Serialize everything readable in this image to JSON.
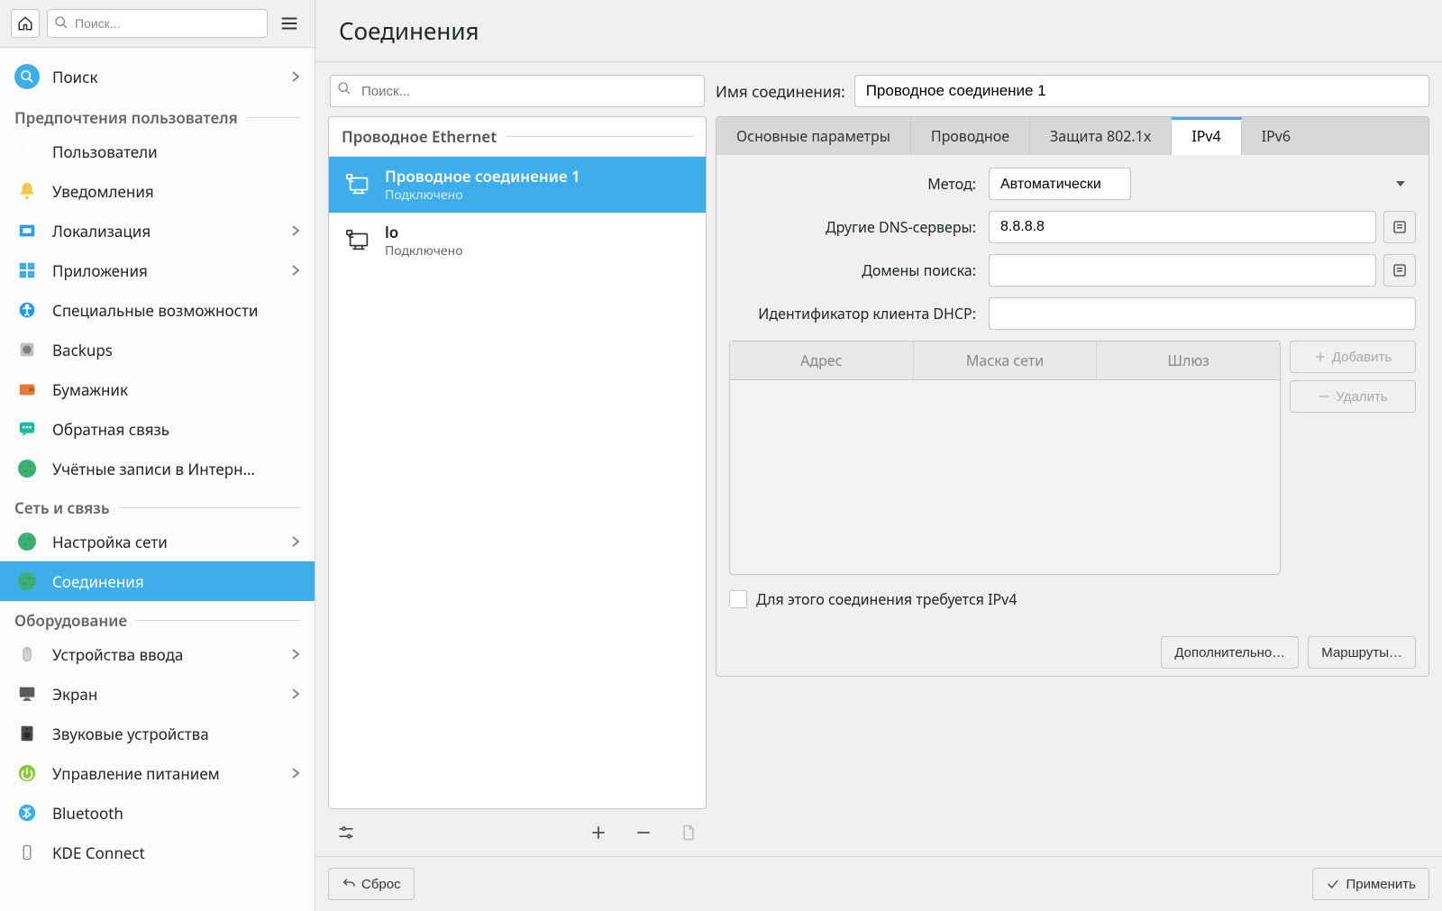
{
  "sidebar": {
    "search_placeholder": "Поиск...",
    "search_item_label": "Поиск",
    "sections": [
      {
        "title": "Предпочтения пользователя",
        "items": [
          {
            "label": "Пользователи",
            "icon": "users",
            "color": "#3daee9",
            "expandable": false
          },
          {
            "label": "Уведомления",
            "icon": "bell",
            "color": "#f2c94c",
            "expandable": false
          },
          {
            "label": "Локализация",
            "icon": "flag",
            "color": "#2b9ce6",
            "expandable": true
          },
          {
            "label": "Приложения",
            "icon": "apps",
            "color": "#3daee9",
            "expandable": true
          },
          {
            "label": "Специальные возможности",
            "icon": "accessibility",
            "color": "#1d99f3",
            "expandable": false
          },
          {
            "label": "Backups",
            "icon": "disk",
            "color": "#7f7f7f",
            "expandable": false
          },
          {
            "label": "Бумажник",
            "icon": "wallet",
            "color": "#e07b3c",
            "expandable": false
          },
          {
            "label": "Обратная связь",
            "icon": "chat",
            "color": "#1abc9c",
            "expandable": false
          },
          {
            "label": "Учётные записи в Интерн…",
            "icon": "globe-accounts",
            "color": "#27ae60",
            "expandable": false
          }
        ]
      },
      {
        "title": "Сеть и связь",
        "items": [
          {
            "label": "Настройка сети",
            "icon": "globe",
            "color": "#27ae60",
            "expandable": true
          },
          {
            "label": "Соединения",
            "icon": "globe",
            "color": "#27ae60",
            "expandable": false,
            "selected": true
          }
        ]
      },
      {
        "title": "Оборудование",
        "items": [
          {
            "label": "Устройства ввода",
            "icon": "mouse",
            "color": "#bdbdbd",
            "expandable": true
          },
          {
            "label": "Экран",
            "icon": "monitor",
            "color": "#5a5a5a",
            "expandable": true
          },
          {
            "label": "Звуковые устройства",
            "icon": "speaker",
            "color": "#4a4a4a",
            "expandable": false
          },
          {
            "label": "Управление питанием",
            "icon": "power",
            "color": "#8fc93a",
            "expandable": true
          },
          {
            "label": "Bluetooth",
            "icon": "bluetooth",
            "color": "#3daee9",
            "expandable": false
          },
          {
            "label": "KDE Connect",
            "icon": "phone",
            "color": "#888",
            "expandable": false
          }
        ]
      }
    ]
  },
  "header": {
    "title": "Соединения"
  },
  "connlist": {
    "search_placeholder": "Поиск...",
    "group_title": "Проводное Ethernet",
    "items": [
      {
        "title": "Проводное соединение 1",
        "sub": "Подключено",
        "selected": true
      },
      {
        "title": "lo",
        "sub": "Подключено",
        "selected": false
      }
    ]
  },
  "details": {
    "name_label": "Имя соединения:",
    "name_value": "Проводное соединение 1",
    "tabs": [
      "Основные параметры",
      "Проводное",
      "Защита 802.1x",
      "IPv4",
      "IPv6"
    ],
    "active_tab": 3,
    "ipv4": {
      "method_label": "Метод:",
      "method_value": "Автоматически",
      "dns_label": "Другие DNS-серверы:",
      "dns_value": "8.8.8.8",
      "search_domains_label": "Домены поиска:",
      "search_domains_value": "",
      "dhcp_client_id_label": "Идентификатор клиента DHCP:",
      "dhcp_client_id_value": "",
      "table_headers": [
        "Адрес",
        "Маска сети",
        "Шлюз"
      ],
      "add_btn": "Добавить",
      "remove_btn": "Удалить",
      "require_ipv4_label": "Для этого соединения требуется IPv4"
    },
    "advanced_btn": "Дополнительно…",
    "routes_btn": "Маршруты…"
  },
  "footer": {
    "reset": "Сброс",
    "apply": "Применить"
  }
}
